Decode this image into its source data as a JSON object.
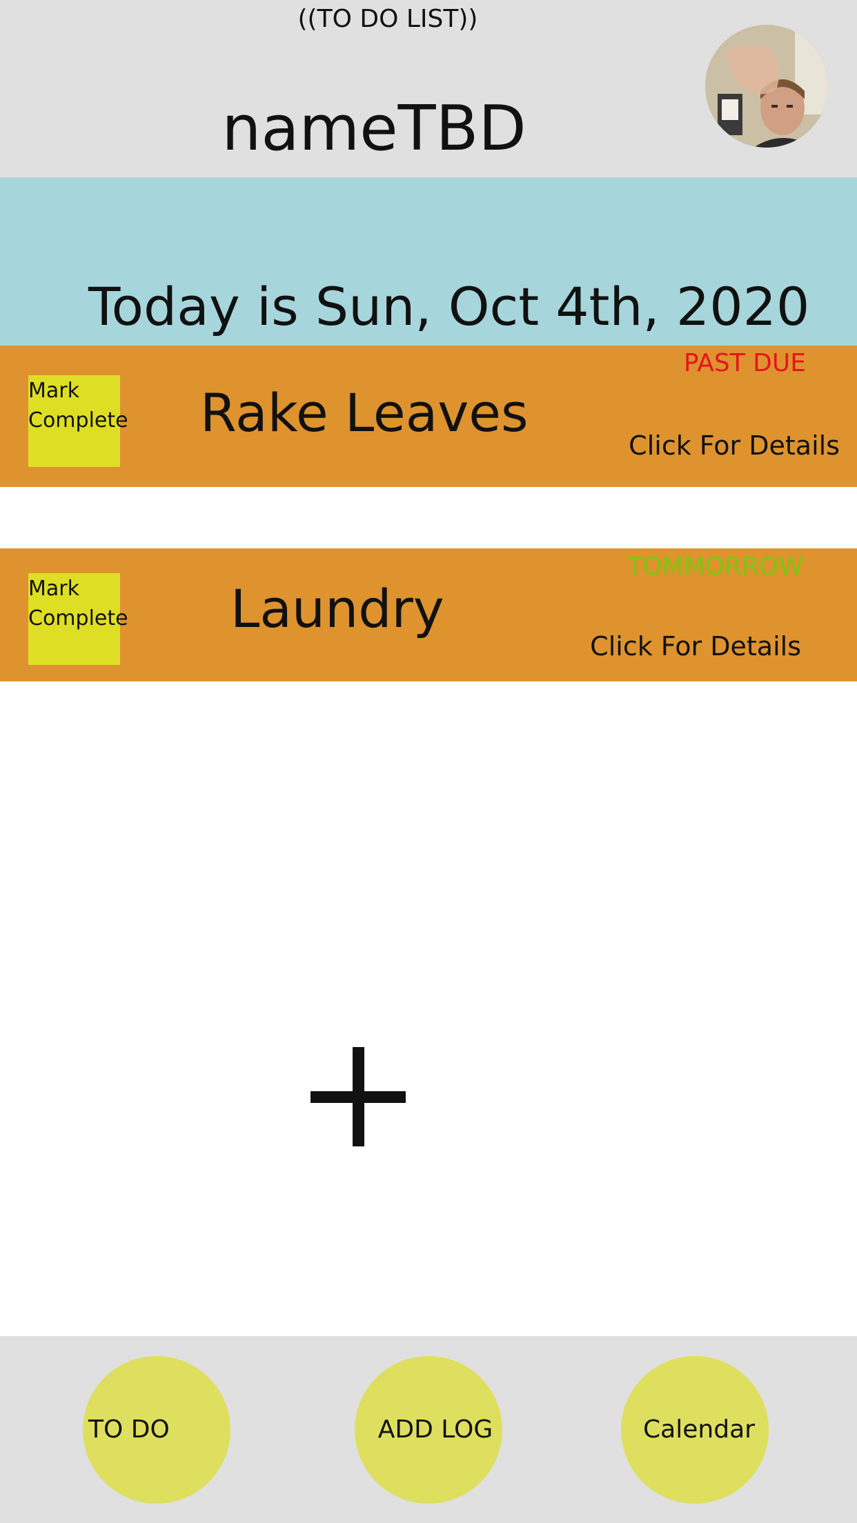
{
  "header": {
    "list_caption": "((TO DO LIST))",
    "app_name": "nameTBD",
    "avatar_icon": "user-photo-avatar"
  },
  "date_banner": {
    "text": "Today is Sun, Oct 4th, 2020"
  },
  "tasks": [
    {
      "name": "Rake Leaves",
      "mark_label_line1": "Mark",
      "mark_label_line2": "Complete",
      "status": "PAST DUE",
      "status_color": "#e8131e",
      "details_label": "Click For Details"
    },
    {
      "name": "Laundry",
      "mark_label_line1": "Mark",
      "mark_label_line2": "Complete",
      "status": "TOMMORROW",
      "status_color": "#79c90f",
      "details_label": "Click For Details"
    }
  ],
  "add_button": {
    "icon": "plus-icon"
  },
  "bottom_nav": {
    "items": [
      {
        "label": "TO DO"
      },
      {
        "label": "ADD LOG"
      },
      {
        "label": "Calendar"
      }
    ]
  },
  "colors": {
    "header_bg": "#e0e0e0",
    "banner_bg": "#a6d6dc",
    "task_bg": "#de932f",
    "mark_bg": "#dedf24",
    "nav_button_bg": "#dedf5e"
  }
}
